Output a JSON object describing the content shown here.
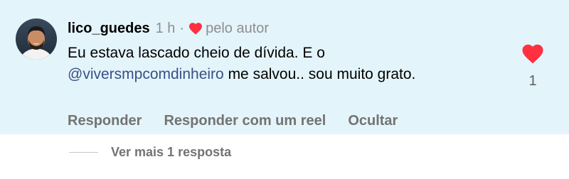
{
  "comment": {
    "username": "lico_guedes",
    "time": "1 h",
    "separator": "·",
    "liked_by_author_label": "pelo autor",
    "text_part1": "Eu estava lascado cheio de dívida. E o ",
    "mention": "@viversmpcomdinheiro",
    "text_part2": " me salvou.. sou muito grato.",
    "like_count": "1",
    "avatar_icon": "user-avatar",
    "like_icon": "heart-icon"
  },
  "actions": {
    "reply": "Responder",
    "reply_with_reel": "Responder com um reel",
    "hide": "Ocultar"
  },
  "replies": {
    "view_more_label": "Ver mais 1 resposta"
  },
  "colors": {
    "highlight_background": "#e4f4fb",
    "heart_red": "#ff3040",
    "mention_blue": "#385185",
    "secondary_text": "#8e8e8e"
  }
}
